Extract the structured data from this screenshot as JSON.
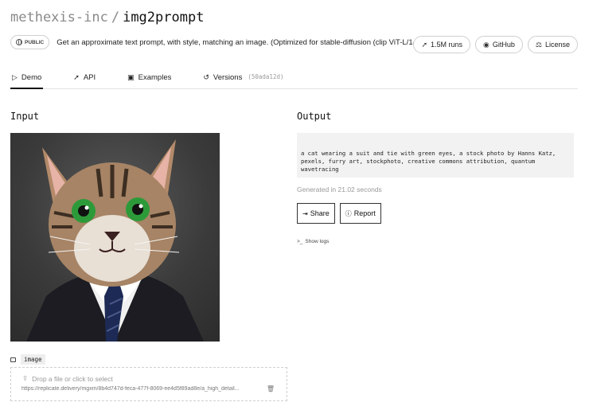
{
  "header": {
    "owner": "methexis-inc",
    "separator": "/",
    "model": "img2prompt",
    "visibility": "PUBLIC",
    "description": "Get an approximate text prompt, with style, matching an image. (Optimized for stable-diffusion (clip ViT-L/14))",
    "runs_label": "1.5M runs",
    "github_label": "GitHub",
    "license_label": "License"
  },
  "tabs": [
    {
      "label": "Demo",
      "icon": "play-icon",
      "active": true
    },
    {
      "label": "API",
      "icon": "rocket-icon"
    },
    {
      "label": "Examples",
      "icon": "examples-icon"
    },
    {
      "label": "Versions",
      "icon": "history-icon",
      "hash": "(50ada12d)"
    }
  ],
  "input": {
    "title": "Input",
    "field_name": "image",
    "drop_prompt": "Drop a file or click to select",
    "file_url": "https://replicate.delivery/mgxm/8b4d747d-feca-477f-8069-ee4d5f89ad8e/a_high_detail..."
  },
  "output": {
    "title": "Output",
    "text": "a cat wearing a suit and tie with green eyes, a stock photo by Hanns Katz, pexels, furry art, stockphoto, creative commons attribution, quantum wavetracing",
    "generated": "Generated in 21.02 seconds",
    "share_label": "Share",
    "report_label": "Report",
    "logs_label": "Show logs"
  }
}
